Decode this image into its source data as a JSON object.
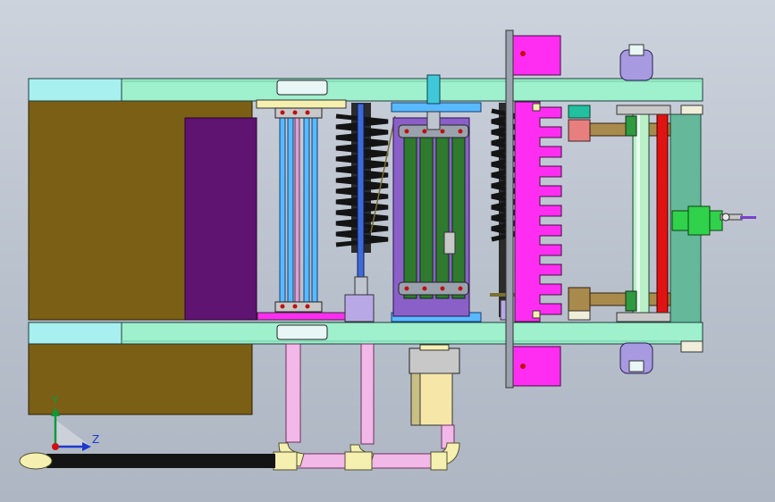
{
  "viewport": {
    "background_top": "#cdd3dd",
    "background_bottom": "#aeb6c3"
  },
  "triad": {
    "y_label": "Y",
    "z_label": "Z",
    "y_color": "#0a9a3a",
    "z_color": "#1a3ad0",
    "x_color": "#d01010"
  },
  "colors": {
    "frame_rail": "#9ff0cc",
    "frame_end": "#a8f0f0",
    "olive_block": "#7a5f15",
    "purple_block": "#5e1470",
    "magenta": "#ff2df2",
    "brush_black": "#141414",
    "roller_green": "#2f7a2f",
    "light_blue": "#59b9ff",
    "pink_pipe": "#f2b8e8",
    "cream": "#f6f0b0",
    "red_bar": "#e01212",
    "salmon": "#e87f7f",
    "tan": "#a98a4d",
    "lavender": "#b8a7e6",
    "green_panel": "#65b89a",
    "teal": "#20c0a0"
  }
}
